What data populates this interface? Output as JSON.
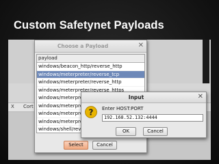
{
  "slide": {
    "title": "Custom Safetynet Payloads"
  },
  "background_app": {
    "tabs": [
      "X",
      "Cort"
    ]
  },
  "payload_dialog": {
    "title": "Choose a Payload",
    "close_glyph": "✕",
    "column_header": "payload",
    "items": [
      "windows/beacon_http/reverse_http",
      "windows/meterpreter/reverse_tcp",
      "windows/meterpreter/reverse_http",
      "windows/meterpreter/reverse_https",
      "windows/meterpret",
      "windows/meterpret",
      "windows/meterpret",
      "windows/meterpret",
      "windows/shell/reve"
    ],
    "selected_index": 1,
    "select_label": "Select",
    "cancel_label": "Cancel"
  },
  "input_dialog": {
    "title": "Input",
    "close_glyph": "✕",
    "prompt": "Enter HOST:PORT",
    "field_value": "192.168.52.132:4444",
    "ok_label": "OK",
    "cancel_label": "Cancel",
    "icon": "warning-icon"
  },
  "colors": {
    "selection": "#6d88b8",
    "primary_button": "#f0a880",
    "warning_icon": "#e8b400"
  }
}
